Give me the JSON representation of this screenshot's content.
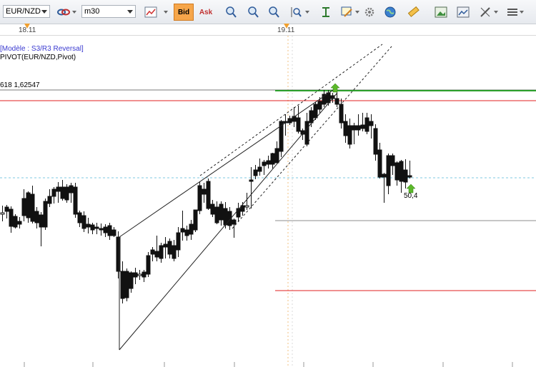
{
  "toolbar": {
    "symbol": "EUR/NZD",
    "timeframe": "m30",
    "bid_label": "Bid",
    "ask_label": "Ask",
    "icons": [
      "link-icon",
      "line-chart-icon",
      "bid-button",
      "ask-button",
      "zoom-in-icon",
      "zoom-out-icon",
      "zoom-fit-icon",
      "zoom-range-icon",
      "indicator-icon",
      "drawing-icon",
      "gear-icon",
      "globe-icon",
      "ruler-icon",
      "image-icon",
      "screenshot-icon",
      "tools-icon",
      "menu-icon"
    ]
  },
  "time_axis": {
    "labels": [
      "18.11",
      "19.11"
    ]
  },
  "info": {
    "model": "[Modèle : S3/R3 Reversal]",
    "indicator": "PIVOT(EUR/NZD,Pivot)",
    "level_label": "618 1,62547"
  },
  "annotations": {
    "value": "50,4"
  },
  "colors": {
    "accent": "#f0a030",
    "green_line": "#2ca02c",
    "red_line": "#e02020",
    "grey_line": "#8c8c8c",
    "dotted_line": "#7fc9e0"
  }
}
